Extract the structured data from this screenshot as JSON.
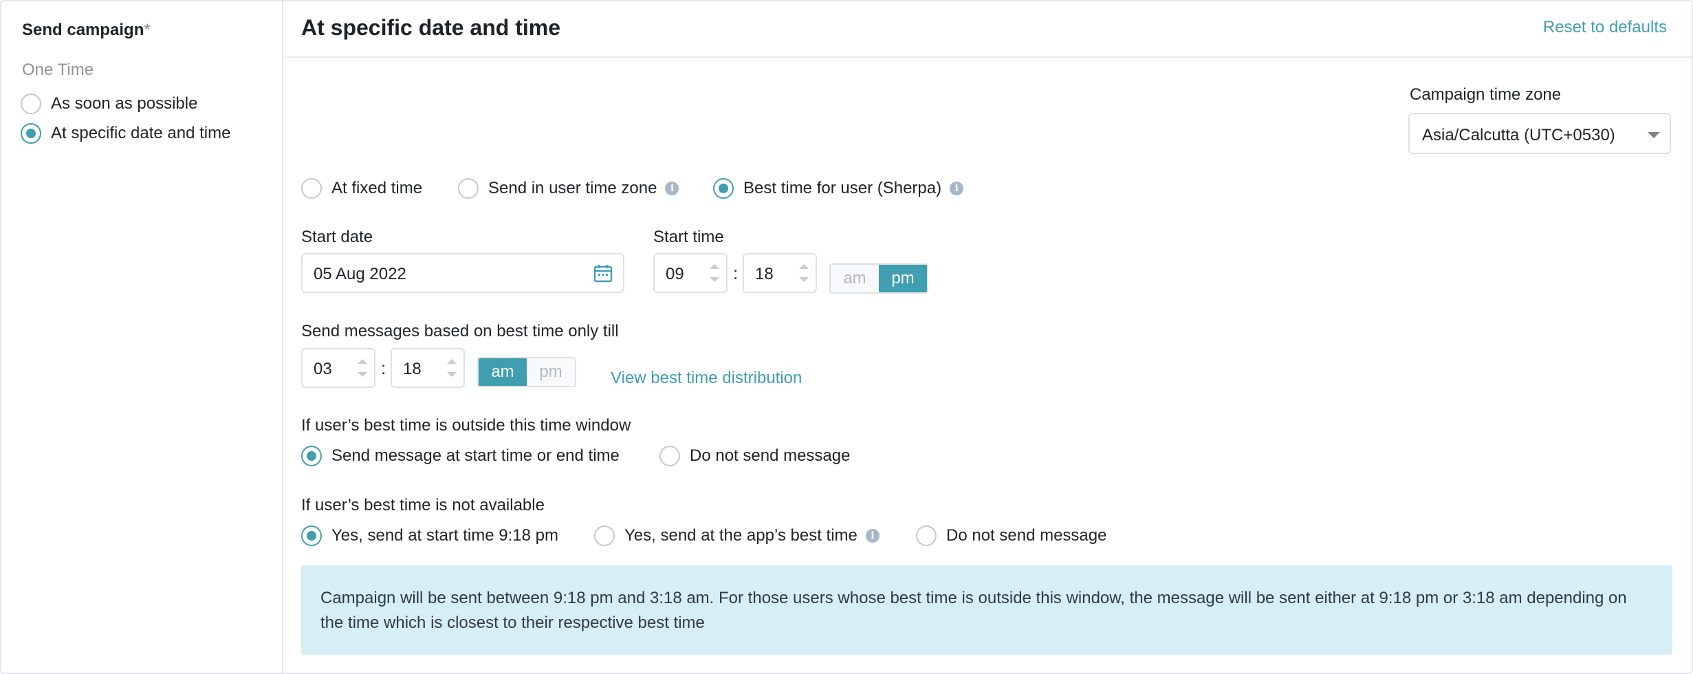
{
  "sidebar": {
    "title": "Send campaign",
    "required_mark": "*",
    "section": "One Time",
    "options": [
      {
        "label": "As soon as possible",
        "selected": false
      },
      {
        "label": "At specific date and time",
        "selected": true
      }
    ]
  },
  "header": {
    "title": "At specific date and time",
    "reset_label": "Reset to defaults"
  },
  "timezone": {
    "label": "Campaign time zone",
    "value": "Asia/Calcutta (UTC+0530)"
  },
  "send_mode": {
    "options": [
      {
        "label": "At fixed time",
        "selected": false,
        "info": false
      },
      {
        "label": "Send in user time zone",
        "selected": false,
        "info": true
      },
      {
        "label": "Best time for user (Sherpa)",
        "selected": true,
        "info": true
      }
    ]
  },
  "start_date": {
    "label": "Start date",
    "value": "05 Aug 2022"
  },
  "start_time": {
    "label": "Start time",
    "hour": "09",
    "separator": ":",
    "minute": "18",
    "am": "am",
    "pm": "pm",
    "selected": "pm"
  },
  "end_time": {
    "label": "Send messages based on best time only till",
    "hour": "03",
    "separator": ":",
    "minute": "18",
    "am": "am",
    "pm": "pm",
    "selected": "am",
    "link": "View best time distribution"
  },
  "outside_window": {
    "label": "If user’s best time is outside this time window",
    "options": [
      {
        "label": "Send message at start time or end time",
        "selected": true
      },
      {
        "label": "Do not send message",
        "selected": false
      }
    ]
  },
  "not_available": {
    "label": "If user’s best time is not available",
    "options": [
      {
        "label": "Yes, send at start time 9:18 pm",
        "selected": true,
        "info": false
      },
      {
        "label": "Yes, send at the app’s best time",
        "selected": false,
        "info": true
      },
      {
        "label": "Do not send message",
        "selected": false,
        "info": false
      }
    ]
  },
  "note": "Campaign will be sent between 9:18 pm and 3:18 am. For those users whose best time is outside this window, the message will be sent either at 9:18 pm or 3:18 am depending on the time which is closest to their respective best time",
  "colors": {
    "accent": "#3f9eb0",
    "note_bg": "#d6eef6",
    "border": "#dde1e5"
  }
}
